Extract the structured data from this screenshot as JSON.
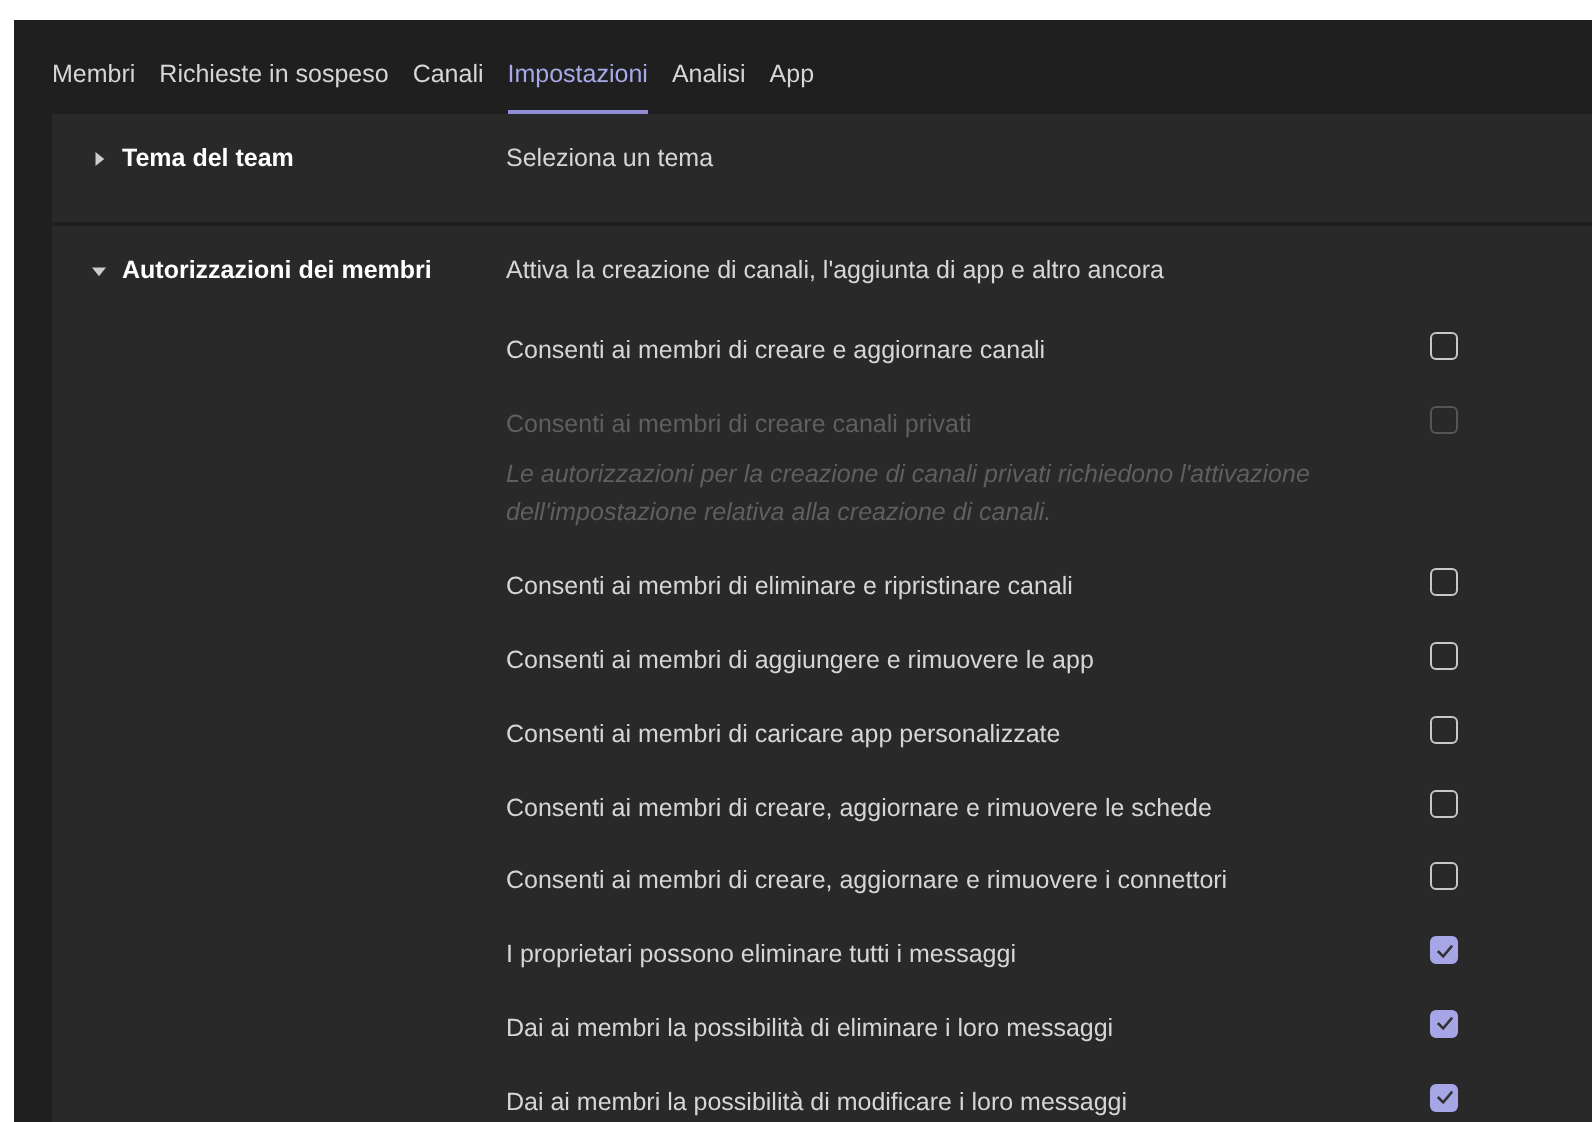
{
  "tabs": [
    {
      "label": "Membri",
      "selected": false
    },
    {
      "label": "Richieste in sospeso",
      "selected": false
    },
    {
      "label": "Canali",
      "selected": false
    },
    {
      "label": "Impostazioni",
      "selected": true
    },
    {
      "label": "Analisi",
      "selected": false
    },
    {
      "label": "App",
      "selected": false
    }
  ],
  "sections": [
    {
      "title": "Tema del team",
      "expanded": false,
      "description": "Seleziona un tema"
    },
    {
      "title": "Autorizzazioni dei membri",
      "expanded": true,
      "description": "Attiva la creazione di canali, l'aggiunta di app e altro ancora",
      "options": [
        {
          "label": "Consenti ai membri di creare e aggiornare canali",
          "checked": false,
          "disabled": false
        },
        {
          "label": "Consenti ai membri di creare canali privati",
          "checked": false,
          "disabled": true,
          "note": "Le autorizzazioni per la creazione di canali privati richiedono l'attivazione dell'impostazione relativa alla creazione di canali."
        },
        {
          "label": "Consenti ai membri di eliminare e ripristinare canali",
          "checked": false,
          "disabled": false
        },
        {
          "label": "Consenti ai membri di aggiungere e rimuovere le app",
          "checked": false,
          "disabled": false
        },
        {
          "label": "Consenti ai membri di caricare app personalizzate",
          "checked": false,
          "disabled": false
        },
        {
          "label": "Consenti ai membri di creare, aggiornare e rimuovere le schede",
          "checked": false,
          "disabled": false
        },
        {
          "label": "Consenti ai membri di creare, aggiornare e rimuovere i connettori",
          "checked": false,
          "disabled": false
        },
        {
          "label": "I proprietari possono eliminare tutti i messaggi",
          "checked": true,
          "disabled": false
        },
        {
          "label": "Dai ai membri la possibilità di eliminare i loro messaggi",
          "checked": true,
          "disabled": false
        },
        {
          "label": "Dai ai membri la possibilità di modificare i loro messaggi",
          "checked": true,
          "disabled": false
        }
      ]
    }
  ]
}
